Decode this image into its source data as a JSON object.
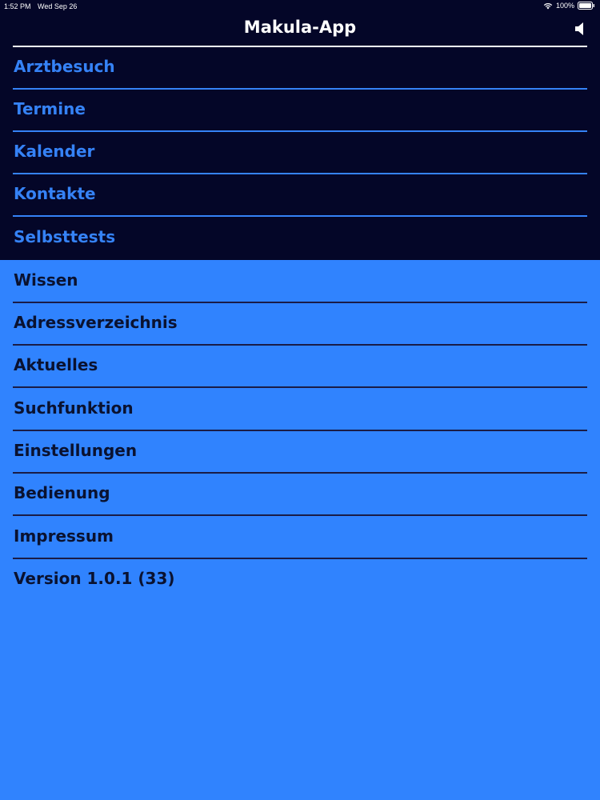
{
  "status_bar": {
    "time": "1:52 PM",
    "date": "Wed Sep 26",
    "battery": "100%",
    "wifi_icon": "wifi-icon",
    "battery_icon": "battery-icon"
  },
  "header": {
    "title": "Makula-App",
    "speaker_icon": "speaker-icon"
  },
  "menu": {
    "primary": [
      {
        "label": "Arztbesuch"
      },
      {
        "label": "Termine"
      },
      {
        "label": "Kalender"
      },
      {
        "label": "Kontakte"
      },
      {
        "label": "Selbsttests"
      }
    ],
    "secondary": [
      {
        "label": "Wissen"
      },
      {
        "label": "Adressverzeichnis"
      },
      {
        "label": "Aktuelles"
      },
      {
        "label": "Suchfunktion"
      },
      {
        "label": "Einstellungen"
      },
      {
        "label": "Bedienung"
      },
      {
        "label": "Impressum"
      }
    ]
  },
  "version": "Version 1.0.1 (33)",
  "colors": {
    "dark_background": "#040628",
    "light_background": "#3083fe",
    "accent_blue": "#3582f6",
    "dark_text": "#0a1230",
    "white": "#ffffff"
  }
}
